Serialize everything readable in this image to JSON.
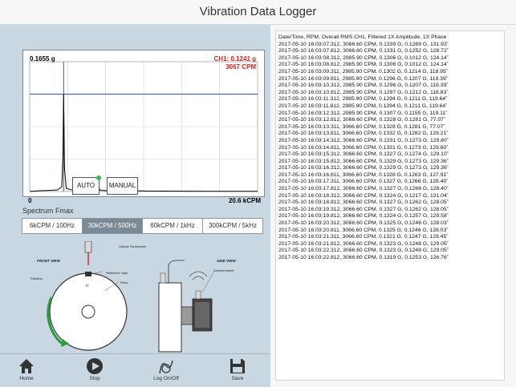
{
  "app": {
    "title": "Vibration Data Logger"
  },
  "chart": {
    "peak_value": "0.1655 g",
    "cursor_channel": "CH1: 0.1241 g",
    "cursor_cpm": "3067 CPM",
    "x_min": "0",
    "x_max": "20.6 kCPM",
    "colors": {
      "cursor": "#3b4fd6",
      "readout": "#e0201e",
      "trace": "#000000"
    }
  },
  "chart_data": {
    "type": "line",
    "title": "",
    "xlabel": "",
    "ylabel": "",
    "x_unit": "kCPM",
    "y_unit": "g",
    "xlim": [
      0,
      20.6
    ],
    "ylim": [
      0,
      0.1655
    ],
    "grid": true,
    "series": [
      {
        "name": "",
        "x": [
          0.0,
          0.5,
          1.0,
          1.5,
          2.0,
          2.5,
          2.9,
          3.0,
          3.067,
          3.15,
          3.3,
          4.0,
          5.0,
          5.8,
          6.05,
          6.1,
          6.15,
          6.4,
          7.0,
          8.0,
          8.9,
          9.2,
          9.5,
          10.5,
          12.0,
          14.0,
          16.0,
          18.0,
          20.6
        ],
        "y": [
          0.0,
          0.0005,
          0.001,
          0.0012,
          0.0015,
          0.002,
          0.006,
          0.045,
          0.1241,
          0.03,
          0.004,
          0.0012,
          0.001,
          0.0015,
          0.008,
          0.013,
          0.006,
          0.0015,
          0.001,
          0.0008,
          0.0012,
          0.004,
          0.001,
          0.0006,
          0.0005,
          0.0004,
          0.0003,
          0.0003,
          0.0002
        ]
      }
    ],
    "cursor": {
      "x": 3.067,
      "y": 0.1241
    }
  },
  "controls": {
    "auto_label": "AUTO",
    "manual_label": "MANUAL",
    "fmax_label": "Spectrum Fmax",
    "fmax_options": [
      "6kCPM / 100Hz",
      "30kCPM / 500Hz",
      "60kCPM / 1kHz",
      "300kCPM / 5kHz"
    ],
    "fmax_selected_index": 1
  },
  "diagram": {
    "front_view": "FRONT VIEW",
    "side_view": "SIDE VIEW",
    "optical_tachometer": "Optical Tachometer",
    "reflective_tape": "Reflective Tape",
    "rotor": "Rotor",
    "rotation": "Rotation",
    "accelerometer": "Accelerometer",
    "zero_deg": "0°"
  },
  "log": {
    "header": "Date/Time, RPM, Overall RMS CH1, Filtered 1X Amplitude, 1X Phase",
    "rows": [
      "2017-05-10 16:03:07.312, 3066.60 CPM, 0.1339 G, 0.1269 G, 131.93˚",
      "2017-05-10 16:03:07.812, 3066.60 CPM, 0.1331 G, 0.1252 G, 128.72˚",
      "2017-05-10 16:03:08.312, 2985.90 CPM, 0.1306 G, 0.1012 G, 124.14˚",
      "2017-05-10 16:03:08.812, 2985.90 CPM, 0.1306 G, 0.1012 G, 124.14˚",
      "2017-05-10 16:03:09.311, 2985.90 CPM, 0.1302 G, 0.1214 G, 118.95˚",
      "2017-05-10 16:03:09.811, 2985.90 CPM, 0.1296 G, 0.1207 G, 119.39˚",
      "2017-05-10 16:03:10.312, 2985.90 CPM, 0.1296 G, 0.1207 G, 119.39˚",
      "2017-05-10 16:03:10.812, 2985.90 CPM, 0.1297 G, 0.1212 G, 118.83˚",
      "2017-05-10 16:03:11.312, 2985.90 CPM, 0.1294 G, 0.1211 G, 119.64˚",
      "2017-05-10 16:03:11.812, 2985.90 CPM, 0.1294 G, 0.1211 G, 119.64˚",
      "2017-05-10 16:03:12.312, 2985.90 CPM, 0.1307 G, 0.1155 G, 119.11˚",
      "2017-05-10 16:03:12.812, 3066.60 CPM, 0.1328 G, 0.1281 G, 77.07˚",
      "2017-05-10 16:03:13.311, 3066.60 CPM, 0.1328 G, 0.1281 G, 77.07˚",
      "2017-05-10 16:03:13.811, 3066.60 CPM, 0.1332 G, 0.1282 G, 129.21˚",
      "2017-05-10 16:03:14.312, 3066.60 CPM, 0.1331 G, 0.1273 G, 129.80˚",
      "2017-05-10 16:03:14.811, 3066.60 CPM, 0.1331 G, 0.1273 G, 129.80˚",
      "2017-05-10 16:03:15.312, 3066.60 CPM, 0.1327 G, 0.1274 G, 129.10˚",
      "2017-05-10 16:03:15.812, 3066.60 CPM, 0.1329 G, 0.1273 G, 129.36˚",
      "2017-05-10 16:03:16.312, 3066.60 CPM, 0.1329 G, 0.1273 G, 129.36˚",
      "2017-05-10 16:03:16.811, 3066.60 CPM, 0.1328 G, 0.1263 G, 127.91˚",
      "2017-05-10 16:03:17.311, 3066.60 CPM, 0.1327 G, 0.1266 G, 128.40˚",
      "2017-05-10 16:03:17.812, 3066.60 CPM, 0.1327 G, 0.1266 G, 128.40˚",
      "2017-05-10 16:03:18.312, 3066.60 CPM, 0.1324 G, 0.1217 G, 131.04˚",
      "2017-05-10 16:03:18.812, 3066.60 CPM, 0.1327 G, 0.1262 G, 128.05˚",
      "2017-05-10 16:03:19.312, 3066.60 CPM, 0.1327 G, 0.1262 G, 128.05˚",
      "2017-05-10 16:03:19.812, 3066.60 CPM, 0.1324 G, 0.1257 G, 129.58˚",
      "2017-05-10 16:03:20.312, 3066.60 CPM, 0.1325 G, 0.1246 G, 128.03˚",
      "2017-05-10 16:03:20.811, 3066.60 CPM, 0.1325 G, 0.1246 G, 128.03˚",
      "2017-05-10 16:03:21.311, 3066.60 CPM, 0.1321 G, 0.1247 G, 129.45˚",
      "2017-05-10 16:03:21.812, 3066.60 CPM, 0.1323 G, 0.1248 G, 129.05˚",
      "2017-05-10 16:03:22.312, 3066.60 CPM, 0.1323 G, 0.1248 G, 129.05˚",
      "2017-05-10 16:03:22.812, 3066.60 CPM, 0.1319 G, 0.1253 G, 126.76˚"
    ]
  },
  "toolbar": {
    "home_label": "Home",
    "stop_label": "Stop",
    "log_label": "Log On/Off",
    "save_label": "Save",
    "icons": [
      "home-icon",
      "stop-icon",
      "log-icon",
      "save-icon"
    ]
  }
}
